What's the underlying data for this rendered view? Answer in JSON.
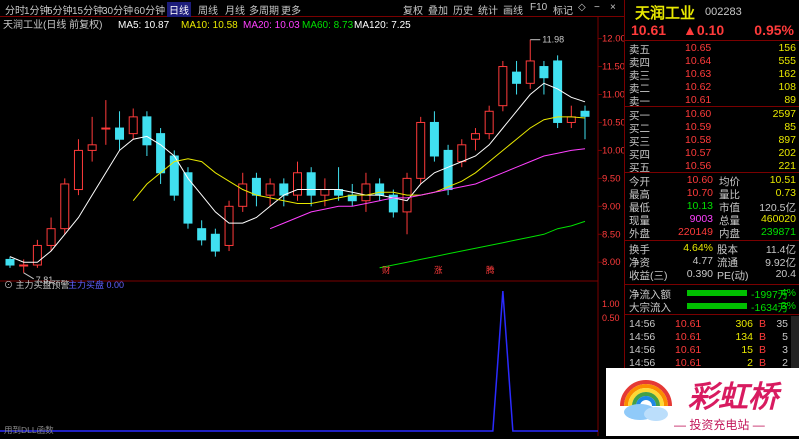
{
  "topbar": {
    "periods": [
      "分时",
      "1分钟",
      "5分钟",
      "15分钟",
      "30分钟",
      "60分钟",
      "日线",
      "周线",
      "月线",
      "多周期",
      "更多"
    ],
    "active_period": "日线",
    "tools": [
      "复权",
      "叠加",
      "历史",
      "统计",
      "画线",
      "F10",
      "标记",
      "◇",
      "−",
      "×"
    ]
  },
  "main_chart": {
    "title": "天润工业(日线 前复权)",
    "ma_labels": [
      {
        "text": "MA5: 10.87",
        "color": "#ffffff"
      },
      {
        "text": "MA10: 10.58",
        "color": "#e8e800"
      },
      {
        "text": "MA20: 10.03",
        "color": "#ff40ff"
      },
      {
        "text": "MA60: 8.73",
        "color": "#00e000"
      },
      {
        "text": "MA120: 7.25",
        "color": "#ffffff"
      }
    ],
    "y_ticks": [
      "12.00",
      "11.50",
      "11.00",
      "10.50",
      "10.00",
      "9.50",
      "9.00",
      "8.50",
      "8.00"
    ],
    "high_label": "11.98",
    "low_label": "7.81",
    "event_markers": [
      "财",
      "涨",
      "腾"
    ]
  },
  "chart_data": {
    "type": "line",
    "title": "天润工业(日线 前复权)",
    "y_range": [
      7.7,
      12.1
    ],
    "candles": [
      {
        "o": 8.05,
        "c": 7.95,
        "h": 8.1,
        "l": 7.9
      },
      {
        "o": 7.95,
        "c": 7.95,
        "h": 8.05,
        "l": 7.81
      },
      {
        "o": 7.95,
        "c": 8.3,
        "h": 8.4,
        "l": 7.9
      },
      {
        "o": 8.3,
        "c": 8.6,
        "h": 8.8,
        "l": 8.2
      },
      {
        "o": 8.6,
        "c": 9.4,
        "h": 9.5,
        "l": 8.5
      },
      {
        "o": 9.3,
        "c": 10.0,
        "h": 10.2,
        "l": 9.2
      },
      {
        "o": 10.0,
        "c": 10.1,
        "h": 10.6,
        "l": 9.8
      },
      {
        "o": 10.4,
        "c": 10.4,
        "h": 10.9,
        "l": 10.1
      },
      {
        "o": 10.4,
        "c": 10.2,
        "h": 10.7,
        "l": 10.0
      },
      {
        "o": 10.3,
        "c": 10.6,
        "h": 10.75,
        "l": 10.2
      },
      {
        "o": 10.6,
        "c": 10.1,
        "h": 10.7,
        "l": 9.9
      },
      {
        "o": 10.3,
        "c": 9.6,
        "h": 10.4,
        "l": 9.4
      },
      {
        "o": 9.9,
        "c": 9.2,
        "h": 10.0,
        "l": 9.1
      },
      {
        "o": 9.6,
        "c": 8.7,
        "h": 9.7,
        "l": 8.6
      },
      {
        "o": 8.6,
        "c": 8.4,
        "h": 8.75,
        "l": 8.3
      },
      {
        "o": 8.5,
        "c": 8.2,
        "h": 8.6,
        "l": 8.1
      },
      {
        "o": 8.3,
        "c": 9.0,
        "h": 9.1,
        "l": 8.2
      },
      {
        "o": 9.0,
        "c": 9.4,
        "h": 9.6,
        "l": 8.9
      },
      {
        "o": 9.5,
        "c": 9.2,
        "h": 9.6,
        "l": 9.0
      },
      {
        "o": 9.2,
        "c": 9.4,
        "h": 9.5,
        "l": 9.0
      },
      {
        "o": 9.4,
        "c": 9.2,
        "h": 9.5,
        "l": 9.0
      },
      {
        "o": 9.2,
        "c": 9.6,
        "h": 9.8,
        "l": 9.1
      },
      {
        "o": 9.6,
        "c": 9.2,
        "h": 9.7,
        "l": 9.0
      },
      {
        "o": 9.2,
        "c": 9.3,
        "h": 9.5,
        "l": 9.0
      },
      {
        "o": 9.3,
        "c": 9.2,
        "h": 9.7,
        "l": 9.1
      },
      {
        "o": 9.2,
        "c": 9.1,
        "h": 9.4,
        "l": 9.0
      },
      {
        "o": 9.1,
        "c": 9.4,
        "h": 9.6,
        "l": 8.9
      },
      {
        "o": 9.4,
        "c": 9.2,
        "h": 9.5,
        "l": 9.1
      },
      {
        "o": 9.2,
        "c": 8.9,
        "h": 9.3,
        "l": 8.8
      },
      {
        "o": 8.9,
        "c": 9.5,
        "h": 9.6,
        "l": 8.5
      },
      {
        "o": 9.5,
        "c": 10.5,
        "h": 10.6,
        "l": 9.4
      },
      {
        "o": 10.5,
        "c": 9.9,
        "h": 10.7,
        "l": 9.8
      },
      {
        "o": 10.0,
        "c": 9.3,
        "h": 10.1,
        "l": 9.2
      },
      {
        "o": 9.8,
        "c": 10.1,
        "h": 10.2,
        "l": 9.7
      },
      {
        "o": 10.2,
        "c": 10.3,
        "h": 10.4,
        "l": 10.0
      },
      {
        "o": 10.3,
        "c": 10.7,
        "h": 10.8,
        "l": 10.2
      },
      {
        "o": 10.8,
        "c": 11.5,
        "h": 11.6,
        "l": 10.7
      },
      {
        "o": 11.4,
        "c": 11.2,
        "h": 11.6,
        "l": 11.0
      },
      {
        "o": 11.2,
        "c": 11.6,
        "h": 11.98,
        "l": 11.1
      },
      {
        "o": 11.5,
        "c": 11.3,
        "h": 11.6,
        "l": 11.0
      },
      {
        "o": 11.6,
        "c": 10.5,
        "h": 11.7,
        "l": 10.4
      },
      {
        "o": 10.5,
        "c": 10.6,
        "h": 10.8,
        "l": 10.4
      },
      {
        "o": 10.7,
        "c": 10.61,
        "h": 10.8,
        "l": 10.2
      }
    ],
    "series": [
      {
        "name": "MA5",
        "color": "#ffffff",
        "values": [
          8.1,
          8.0,
          8.0,
          8.2,
          8.5,
          8.8,
          9.2,
          9.6,
          10.0,
          10.2,
          10.25,
          10.1,
          9.9,
          9.5,
          9.2,
          8.9,
          8.7,
          8.7,
          8.8,
          9.0,
          9.2,
          9.3,
          9.3,
          9.3,
          9.3,
          9.25,
          9.2,
          9.2,
          9.15,
          9.1,
          9.4,
          9.6,
          9.7,
          9.8,
          9.9,
          10.1,
          10.4,
          10.7,
          11.0,
          11.2,
          11.1,
          10.95,
          10.87
        ]
      },
      {
        "name": "MA10",
        "color": "#e8e800",
        "values": [
          null,
          null,
          null,
          null,
          null,
          null,
          null,
          null,
          null,
          9.1,
          9.4,
          9.6,
          9.8,
          9.85,
          9.8,
          9.6,
          9.45,
          9.3,
          9.2,
          9.15,
          9.1,
          9.05,
          9.05,
          9.1,
          9.15,
          9.2,
          9.2,
          9.25,
          9.25,
          9.2,
          9.2,
          9.25,
          9.35,
          9.45,
          9.6,
          9.8,
          10.0,
          10.2,
          10.4,
          10.55,
          10.6,
          10.6,
          10.58
        ]
      },
      {
        "name": "MA20",
        "color": "#ff40ff",
        "values": [
          null,
          null,
          null,
          null,
          null,
          null,
          null,
          null,
          null,
          null,
          null,
          null,
          null,
          null,
          null,
          null,
          null,
          null,
          null,
          8.6,
          8.7,
          8.8,
          8.9,
          8.95,
          9.0,
          9.0,
          9.05,
          9.1,
          9.15,
          9.15,
          9.2,
          9.25,
          9.3,
          9.35,
          9.4,
          9.5,
          9.6,
          9.7,
          9.8,
          9.9,
          9.95,
          10.0,
          10.03
        ]
      },
      {
        "name": "MA60",
        "color": "#00e000",
        "values": [
          null,
          null,
          null,
          null,
          null,
          null,
          null,
          null,
          null,
          null,
          null,
          null,
          null,
          null,
          null,
          null,
          null,
          null,
          null,
          null,
          null,
          null,
          null,
          null,
          null,
          null,
          null,
          7.9,
          7.95,
          8.0,
          8.05,
          8.1,
          8.15,
          8.2,
          8.25,
          8.3,
          8.35,
          8.4,
          8.45,
          8.5,
          8.6,
          8.65,
          8.73
        ]
      }
    ],
    "indicator": {
      "title": "主力买盘预警",
      "line_label": "主力买盘 0.00",
      "spike_index": 36,
      "spike_value": 1
    }
  },
  "indicator_panel": {
    "title": "主力买盘预警",
    "line_label": "主力买盘 0.00",
    "footer": "用到DLL函数"
  },
  "quote": {
    "name": "天润工业",
    "code": "002283",
    "price": "10.61",
    "change": "▲0.10",
    "change_pct": "0.95%",
    "asks": [
      {
        "label": "卖五",
        "price": "10.65",
        "vol": "156"
      },
      {
        "label": "卖四",
        "price": "10.64",
        "vol": "555"
      },
      {
        "label": "卖三",
        "price": "10.63",
        "vol": "162"
      },
      {
        "label": "卖二",
        "price": "10.62",
        "vol": "108"
      },
      {
        "label": "卖一",
        "price": "10.61",
        "vol": "89"
      }
    ],
    "bids": [
      {
        "label": "买一",
        "price": "10.60",
        "vol": "2597"
      },
      {
        "label": "买二",
        "price": "10.59",
        "vol": "85"
      },
      {
        "label": "买三",
        "price": "10.58",
        "vol": "897"
      },
      {
        "label": "买四",
        "price": "10.57",
        "vol": "202"
      },
      {
        "label": "买五",
        "price": "10.56",
        "vol": "221"
      }
    ],
    "stats": [
      {
        "l1": "今开",
        "v1": "10.60",
        "c1": "#ff3b3b",
        "l2": "均价",
        "v2": "10.51",
        "c2": "#e8e800"
      },
      {
        "l1": "最高",
        "v1": "10.70",
        "c1": "#ff3b3b",
        "l2": "量比",
        "v2": "0.73",
        "c2": "#e8e800"
      },
      {
        "l1": "最低",
        "v1": "10.13",
        "c1": "#00e000",
        "l2": "市值",
        "v2": "120.5亿",
        "c2": "#c8c8c8"
      },
      {
        "l1": "现量",
        "v1": "9003",
        "c1": "#ff40ff",
        "l2": "总量",
        "v2": "460020",
        "c2": "#e8e800"
      },
      {
        "l1": "外盘",
        "v1": "220149",
        "c1": "#ff3b3b",
        "l2": "内盘",
        "v2": "239871",
        "c2": "#00e000"
      }
    ],
    "stats2": [
      {
        "l1": "换手",
        "v1": "4.64%",
        "c1": "#e8e800",
        "l2": "股本",
        "v2": "11.4亿",
        "c2": "#c8c8c8"
      },
      {
        "l1": "净资",
        "v1": "4.77",
        "c1": "#c8c8c8",
        "l2": "流通",
        "v2": "9.92亿",
        "c2": "#c8c8c8"
      },
      {
        "l1": "收益(三)",
        "v1": "0.390",
        "c1": "#c8c8c8",
        "l2": "PE(动)",
        "v2": "20.4",
        "c2": "#c8c8c8"
      }
    ],
    "flows": [
      {
        "label": "净流入额",
        "value": "-1997万",
        "pct": "-4%"
      },
      {
        "label": "大宗流入",
        "value": "-1634万",
        "pct": "-3%"
      }
    ],
    "ticks": [
      {
        "time": "14:56",
        "price": "10.61",
        "vol": "306",
        "bs": "B",
        "n": "35"
      },
      {
        "time": "14:56",
        "price": "10.61",
        "vol": "134",
        "bs": "B",
        "n": "5"
      },
      {
        "time": "14:56",
        "price": "10.61",
        "vol": "15",
        "bs": "B",
        "n": "3"
      },
      {
        "time": "14:56",
        "price": "10.61",
        "vol": "2",
        "bs": "B",
        "n": "2"
      }
    ],
    "scroll_marks": [
      "1.00",
      "0.50"
    ]
  },
  "logo": {
    "brand": "彩虹桥",
    "slogan": "投资充电站"
  }
}
